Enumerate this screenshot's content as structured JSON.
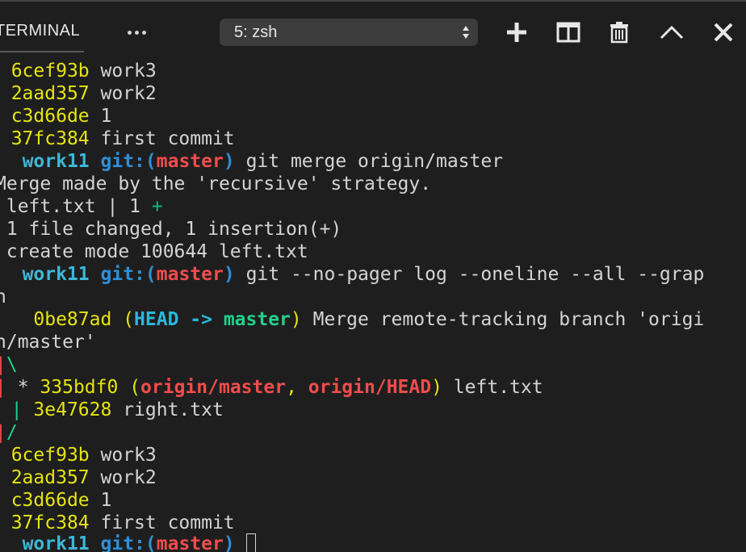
{
  "header": {
    "tab_label": "TERMINAL",
    "terminal_select_value": "5: zsh"
  },
  "terminal": {
    "lines": [
      {
        "prefix": "* ",
        "hash": "6cef93b",
        "text": " work3"
      },
      {
        "prefix": "* ",
        "hash": "2aad357",
        "text": " work2"
      },
      {
        "prefix": "* ",
        "hash": "c3d66de",
        "text": " 1"
      },
      {
        "prefix": "* ",
        "hash": "37fc384",
        "text": " first commit"
      },
      {
        "prompt_arrow": "➜",
        "dir": "work11",
        "git": "git:(",
        "branch": "master",
        "git_close": ")",
        "command": " git merge origin/master"
      },
      {
        "text": "Merge made by the 'recursive' strategy."
      },
      {
        "text": " left.txt | 1 ",
        "plus": "+"
      },
      {
        "text": " 1 file changed, 1 insertion(+)"
      },
      {
        "text": " create mode 100644 left.txt"
      },
      {
        "prompt_arrow": "➜",
        "dir": "work11",
        "git": "git:(",
        "branch": "master",
        "git_close": ")",
        "command": " git --no-pager log --oneline --all --grap"
      },
      {
        "text": "h"
      },
      {
        "prefix": "*   ",
        "hash": "0be87ad",
        "open": " (",
        "head": "HEAD -> ",
        "head_branch": "master",
        "close": ")",
        "text": " Merge remote-tracking branch 'origi"
      },
      {
        "text": "n/master'"
      },
      {
        "graph1": "|",
        "graph2": "\\"
      },
      {
        "graph1": "| ",
        "star": "* ",
        "hash": "335bdf0",
        "open": " (",
        "ref1": "origin/master",
        "sep": ", ",
        "ref2": "origin/HEAD",
        "close": ")",
        "text": " left.txt"
      },
      {
        "prefix": "* ",
        "graph1": "| ",
        "hash": "3e47628",
        "text": " right.txt"
      },
      {
        "graph1": "|",
        "graph2": "/"
      },
      {
        "prefix": "* ",
        "hash": "6cef93b",
        "text": " work3"
      },
      {
        "prefix": "* ",
        "hash": "2aad357",
        "text": " work2"
      },
      {
        "prefix": "* ",
        "hash": "c3d66de",
        "text": " 1"
      },
      {
        "prefix": "* ",
        "hash": "37fc384",
        "text": " first commit"
      },
      {
        "prompt_arrow": "➜",
        "dir": "work11",
        "git": "git:(",
        "branch": "master",
        "git_close": ")",
        "command": " "
      }
    ]
  },
  "colors": {
    "background": "#1e1e1e",
    "hash_yellow": "#e5e510",
    "prompt_green": "#23d18b",
    "dir_cyan": "#29b8db",
    "branch_red": "#f14c4c"
  },
  "icons": [
    "more-icon",
    "plus-icon",
    "split-icon",
    "trash-icon",
    "chevron-up-icon",
    "close-icon"
  ]
}
